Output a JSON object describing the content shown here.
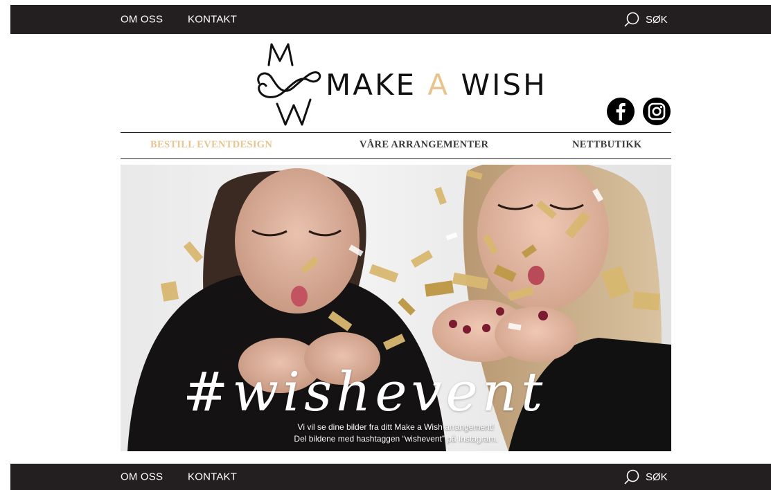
{
  "top_nav": {
    "about": "OM OSS",
    "contact": "KONTAKT",
    "search": "SØK"
  },
  "logo": {
    "word1": "MAKE ",
    "word_accent": "A",
    "word2": " WISH",
    "accent_color": "#e8c48e"
  },
  "social": {
    "facebook_icon": "facebook-icon",
    "instagram_icon": "instagram-icon"
  },
  "main_nav": {
    "items": [
      {
        "label": "BESTILL EVENTDESIGN",
        "active": true
      },
      {
        "label": "VÅRE ARRANGEMENTER",
        "active": false
      },
      {
        "label": "NETTBUTIKK",
        "active": false
      }
    ]
  },
  "hero": {
    "hashtag": "#wishevent",
    "line1": "Vi vil se dine bilder fra ditt Make a Wish arrangement!",
    "line2": "Del bildene med hashtaggen “wishevent” på Instagram."
  },
  "footer_nav": {
    "about": "OM OSS",
    "contact": "KONTAKT",
    "search": "SØK"
  },
  "colors": {
    "bar": "#231f20",
    "accent": "#e8c48e",
    "nav_text": "#3b3b3b"
  }
}
